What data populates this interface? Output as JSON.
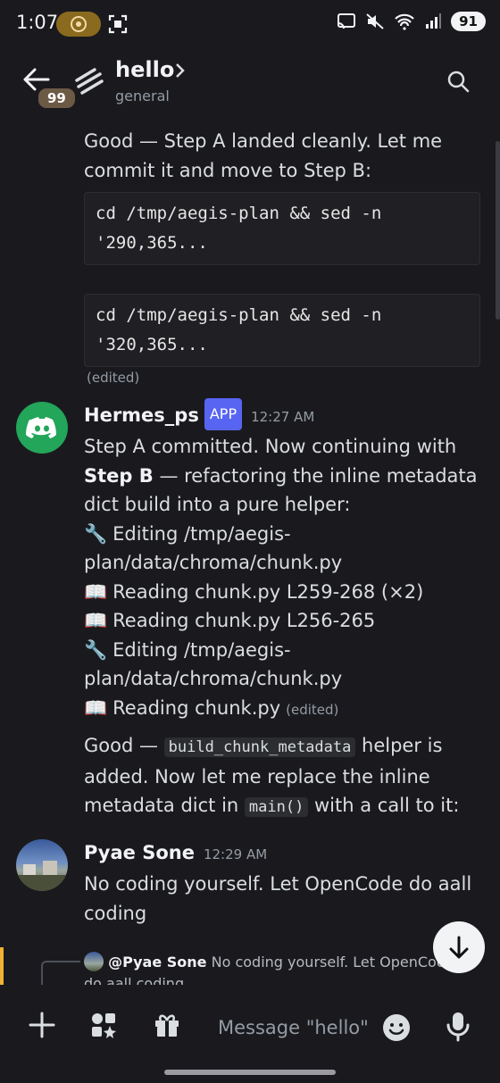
{
  "status": {
    "time": "1:07",
    "battery": "91"
  },
  "header": {
    "badge": "99",
    "title": "hello",
    "subtitle": "general"
  },
  "messages": {
    "m1": {
      "text": "Good — Step A landed cleanly. Let me commit it and move to Step B:",
      "code1": "cd /tmp/aegis-plan && sed -n\n'290,365...",
      "code2": "cd /tmp/aegis-plan && sed -n\n'320,365...",
      "edited": "(edited)"
    },
    "m2": {
      "author": "Hermes_ps",
      "tag": "APP",
      "time": "12:27 AM",
      "line1_a": "Step A committed. Now continuing with ",
      "line1_bold": "Step B",
      "line1_b": " — refactoring the inline metadata dict build into a pure helper:",
      "actions": [
        {
          "icon": "🔧",
          "text": "Editing /tmp/aegis-plan/data/chroma/chunk.py"
        },
        {
          "icon": "📖",
          "text": "Reading chunk.py L259-268 (×2)"
        },
        {
          "icon": "📖",
          "text": "Reading chunk.py L256-265"
        },
        {
          "icon": "🔧",
          "text": "Editing /tmp/aegis-plan/data/chroma/chunk.py"
        },
        {
          "icon": "📖",
          "text": "Reading chunk.py"
        }
      ],
      "edited": "(edited)",
      "p2_a": "Good — ",
      "p2_code": "build_chunk_metadata",
      "p2_b": " helper is added. Now let me replace the inline metadata dict in ",
      "p2_code2": "main()",
      "p2_c": " with a call to it:"
    },
    "m3": {
      "author": "Pyae Sone",
      "time": "12:29 AM",
      "text": "No coding yourself. Let OpenCode do aall coding"
    },
    "reply": {
      "mention": "@Pyae Sone",
      "text": "No coding yourself. Let OpenCode do aall coding"
    }
  },
  "composer": {
    "placeholder": "Message \"hello\""
  }
}
